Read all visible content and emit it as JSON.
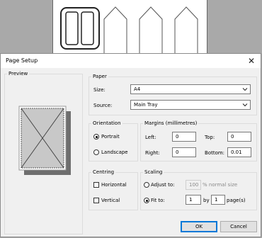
{
  "dialog": {
    "title": "Page Setup"
  },
  "preview": {
    "label": "Preview"
  },
  "paper": {
    "label": "Paper",
    "size_label": "Size:",
    "size_value": "A4",
    "source_label": "Source:",
    "source_value": "Main Tray"
  },
  "orientation": {
    "label": "Orientation",
    "portrait": "Portrait",
    "landscape": "Landscape",
    "selected": "Portrait"
  },
  "margins": {
    "label": "Margins (millimetres)",
    "left_label": "Left:",
    "left_value": "0",
    "top_label": "Top:",
    "top_value": "0",
    "right_label": "Right:",
    "right_value": "0",
    "bottom_label": "Bottom:",
    "bottom_value": "0.01"
  },
  "centring": {
    "label": "Centring",
    "horizontal": "Horizontal",
    "vertical": "Vertical"
  },
  "scaling": {
    "label": "Scaling",
    "adjust_label": "Adjust to:",
    "adjust_value": "100",
    "adjust_suffix": "% normal size",
    "fit_label": "Fit to:",
    "fit_x": "1",
    "by_label": "by",
    "fit_y": "1",
    "pages_label": "page(s)",
    "selected": "Fit to"
  },
  "buttons": {
    "ok": "OK",
    "cancel": "Cancel"
  },
  "colors": {
    "accent": "#0078d7",
    "dialog_bg": "#f0f0f0",
    "backdrop": "#a9a9a9"
  }
}
